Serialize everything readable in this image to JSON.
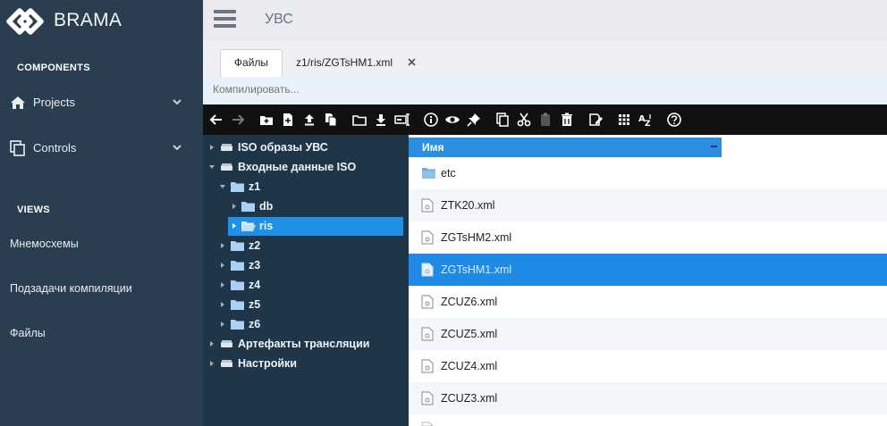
{
  "app": {
    "brand": "BRAMA",
    "page_title": "УВС"
  },
  "sidebar": {
    "components_title": "COMPONENTS",
    "items": [
      {
        "label": "Projects",
        "icon": "home-icon"
      },
      {
        "label": "Controls",
        "icon": "copy-icon"
      }
    ],
    "views_title": "VIEWS",
    "views": [
      {
        "label": "Мнемосхемы"
      },
      {
        "label": "Подзадачи компиляции"
      },
      {
        "label": "Файлы"
      }
    ]
  },
  "tabs": [
    {
      "label": "Файлы",
      "active": true
    },
    {
      "label": "z1/ris/ZGTsHM1.xml",
      "active": false,
      "closable": true
    }
  ],
  "compile": {
    "placeholder": "Компилировать..."
  },
  "toolbar": {
    "icons": [
      "arrow-left-icon",
      "arrow-right-icon",
      "new-folder-icon",
      "new-file-icon",
      "upload-icon",
      "copy-files-icon",
      "folder-icon",
      "download-icon",
      "rename-icon",
      "info-icon",
      "eye-icon",
      "pin-icon",
      "copy-icon",
      "cut-icon",
      "paste-icon",
      "delete-icon",
      "edit-icon",
      "grid-view-icon",
      "sort-az-icon",
      "help-icon"
    ]
  },
  "tree": {
    "nodes": [
      {
        "label": "ISO образы УВС",
        "kind": "drive",
        "expanded": false
      },
      {
        "label": "Входные данные ISO",
        "kind": "drive",
        "expanded": true
      },
      {
        "label": "z1",
        "kind": "folder",
        "expanded": true
      },
      {
        "label": "db",
        "kind": "folder",
        "expanded": false
      },
      {
        "label": "ris",
        "kind": "folder",
        "expanded": false,
        "selected": true
      },
      {
        "label": "z2",
        "kind": "folder",
        "expanded": false
      },
      {
        "label": "z3",
        "kind": "folder",
        "expanded": false
      },
      {
        "label": "z4",
        "kind": "folder",
        "expanded": false
      },
      {
        "label": "z5",
        "kind": "folder",
        "expanded": false
      },
      {
        "label": "z6",
        "kind": "folder",
        "expanded": false
      },
      {
        "label": "Артефакты трансляции",
        "kind": "drive",
        "expanded": false
      },
      {
        "label": "Настройки",
        "kind": "drive",
        "expanded": false
      }
    ]
  },
  "grid": {
    "column_header": "Имя",
    "rows": [
      {
        "name": "etc",
        "type": "folder"
      },
      {
        "name": "ZTK20.xml",
        "type": "file"
      },
      {
        "name": "ZGTsHM2.xml",
        "type": "file"
      },
      {
        "name": "ZGTsHM1.xml",
        "type": "file",
        "selected": true
      },
      {
        "name": "ZCUZ6.xml",
        "type": "file"
      },
      {
        "name": "ZCUZ5.xml",
        "type": "file"
      },
      {
        "name": "ZCUZ4.xml",
        "type": "file"
      },
      {
        "name": "ZCUZ3.xml",
        "type": "file"
      }
    ]
  },
  "colors": {
    "sidebar_bg": "#2b3e50",
    "tree_bg": "#1f3649",
    "accent": "#1e8ae6",
    "toolbar_bg": "#111111"
  }
}
